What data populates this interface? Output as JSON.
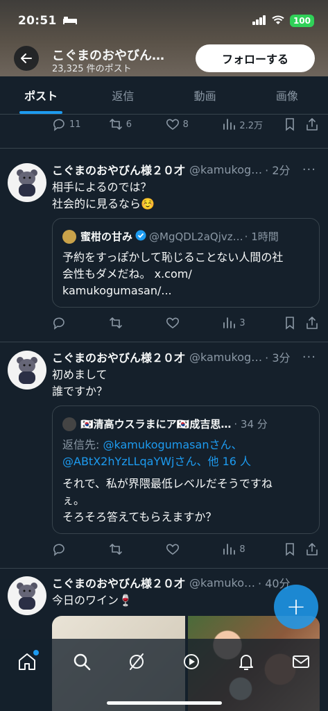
{
  "status_bar": {
    "time": "20:51",
    "battery": "100"
  },
  "header": {
    "name": "こぐまのおやびん…",
    "post_count": "23,325 件のポスト",
    "follow_label": "フォローする"
  },
  "tabs": [
    {
      "label": "ポスト",
      "active": true
    },
    {
      "label": "返信",
      "active": false
    },
    {
      "label": "動画",
      "active": false
    },
    {
      "label": "画像",
      "active": false
    }
  ],
  "top_actions": {
    "replies": "11",
    "reposts": "6",
    "likes": "8",
    "views": "2.2万"
  },
  "tweets": [
    {
      "name": "こぐまのおやびん様２０才",
      "handle": "@kamukog…",
      "time": "· 2分",
      "text": [
        "相手によるのでは？",
        "社会的に見るなら☺️"
      ],
      "quote": {
        "name": "蜜柑の甘み",
        "handle": "@MgQDL2aQjvz…",
        "time": "· 1時間",
        "text": [
          "予約をすっぽかして恥じることない人間の社",
          "会性もダメだね。 x.com/",
          "kamukogumasan/..."
        ]
      },
      "views": "3"
    },
    {
      "name": "こぐまのおやびん様２０才",
      "handle": "@kamukog…",
      "time": "· 3分",
      "text": [
        "初めまして",
        "誰ですか？"
      ],
      "quote": {
        "name": "🇰🇷清高ウスラまにア🇰🇷成吉思…",
        "time": "· 34 分",
        "reply_prefix": "返信先: ",
        "reply_user1": "@kamukogumasan",
        "reply_sep1": "さん、",
        "reply_user2": "@ABtX2hYzLLqaYWj",
        "reply_sep2": "さん、",
        "reply_more": "他 16 人",
        "text": [
          "それで、私が界隈最低レベルだそうですね",
          "ぇ。",
          "そろそろ答えてもらえますか？"
        ]
      },
      "views": "8"
    },
    {
      "name": "こぐまのおやびん様２０才",
      "handle": "@kamuko…",
      "time": "· 40分",
      "text": [
        "今日のワイン🍷"
      ]
    }
  ],
  "colors": {
    "background": "#15202b",
    "accent": "#1d9bf0",
    "muted": "#8b98a5",
    "border": "#38444d"
  },
  "nav": [
    "home-icon",
    "search-icon",
    "grok-icon",
    "spaces-icon",
    "notifications-icon",
    "messages-icon"
  ]
}
